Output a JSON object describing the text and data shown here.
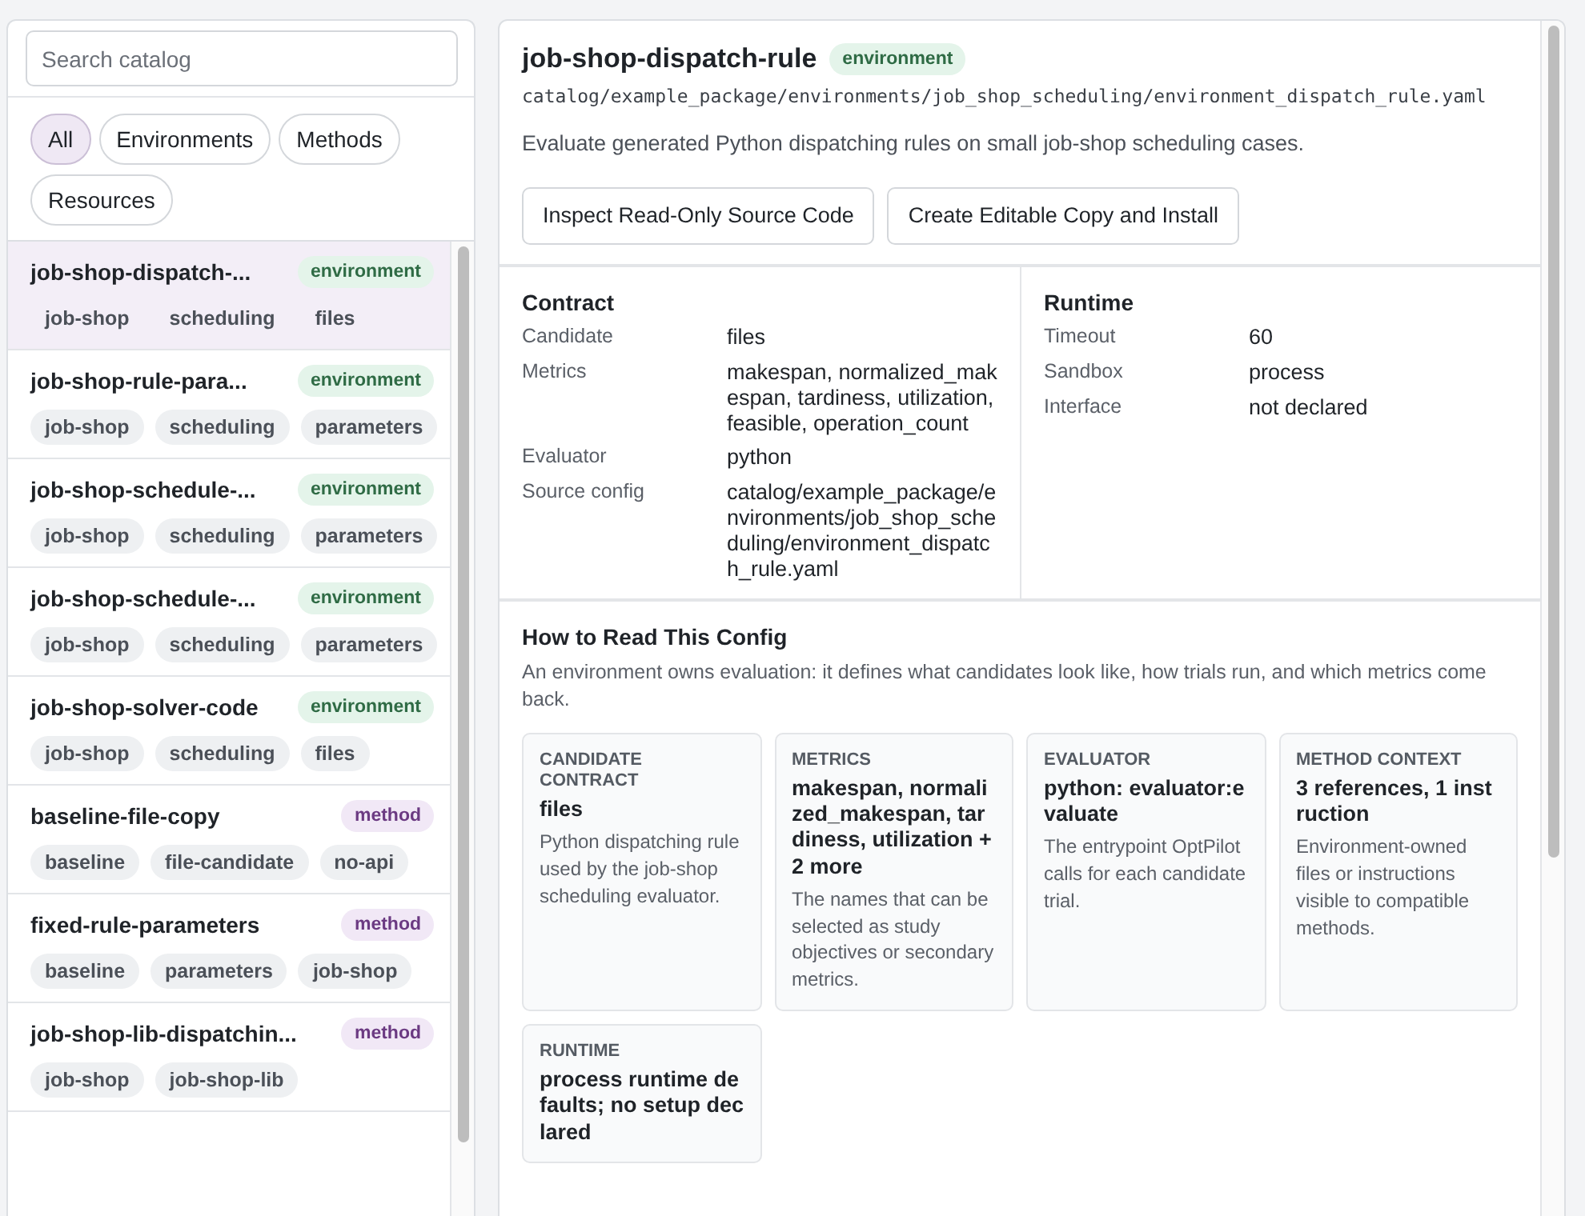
{
  "search": {
    "placeholder": "Search catalog"
  },
  "filters": [
    {
      "label": "All",
      "selected": true
    },
    {
      "label": "Environments",
      "selected": false
    },
    {
      "label": "Methods",
      "selected": false
    },
    {
      "label": "Resources",
      "selected": false
    }
  ],
  "items": [
    {
      "name": "job-shop-dispatch-...",
      "badge": "environment",
      "kind": "environment",
      "selected": true,
      "tags": [
        "job-shop",
        "scheduling",
        "files"
      ]
    },
    {
      "name": "job-shop-rule-para...",
      "badge": "environment",
      "kind": "environment",
      "selected": false,
      "tags": [
        "job-shop",
        "scheduling",
        "parameters"
      ]
    },
    {
      "name": "job-shop-schedule-...",
      "badge": "environment",
      "kind": "environment",
      "selected": false,
      "tags": [
        "job-shop",
        "scheduling",
        "parameters"
      ]
    },
    {
      "name": "job-shop-schedule-...",
      "badge": "environment",
      "kind": "environment",
      "selected": false,
      "tags": [
        "job-shop",
        "scheduling",
        "parameters"
      ]
    },
    {
      "name": "job-shop-solver-code",
      "badge": "environment",
      "kind": "environment",
      "selected": false,
      "tags": [
        "job-shop",
        "scheduling",
        "files"
      ]
    },
    {
      "name": "baseline-file-copy",
      "badge": "method",
      "kind": "method",
      "selected": false,
      "tags": [
        "baseline",
        "file-candidate",
        "no-api"
      ]
    },
    {
      "name": "fixed-rule-parameters",
      "badge": "method",
      "kind": "method",
      "selected": false,
      "tags": [
        "baseline",
        "parameters",
        "job-shop"
      ]
    },
    {
      "name": "job-shop-lib-dispatchin...",
      "badge": "method",
      "kind": "method",
      "selected": false,
      "tags": [
        "job-shop",
        "job-shop-lib"
      ]
    }
  ],
  "detail": {
    "title": "job-shop-dispatch-rule",
    "badge": "environment",
    "kind": "environment",
    "path": "catalog/example_package/environments/job_shop_scheduling/environment_dispatch_rule.yaml",
    "description": "Evaluate generated Python dispatching rules on small job-shop scheduling cases.",
    "buttons": [
      "Inspect Read-Only Source Code",
      "Create Editable Copy and Install"
    ],
    "sections": [
      {
        "title": "Contract",
        "rows": [
          {
            "label": "Candidate",
            "value": "files"
          },
          {
            "label": "Metrics",
            "value": "makespan, normalized_makespan, tardiness, utilization, feasible, operation_count"
          },
          {
            "label": "Evaluator",
            "value": "python"
          },
          {
            "label": "Source config",
            "value": "catalog/example_package/environments/job_shop_scheduling/environment_dispatch_rule.yaml"
          }
        ]
      },
      {
        "title": "Runtime",
        "rows": [
          {
            "label": "Timeout",
            "value": "60"
          },
          {
            "label": "Sandbox",
            "value": "process"
          },
          {
            "label": "Interface",
            "value": "not declared"
          }
        ]
      }
    ],
    "guide": {
      "title": "How to Read This Config",
      "intro": "An environment owns evaluation: it defines what candidates look like, how trials run, and which metrics come back.",
      "cards": [
        {
          "label": "CANDIDATE CONTRACT",
          "value": "files",
          "note": "Python dispatching rule used by the job-shop scheduling evaluator."
        },
        {
          "label": "METRICS",
          "value": "makespan, normalized_makespan, tardiness, utilization +2 more",
          "note": "The names that can be selected as study objectives or secondary metrics."
        },
        {
          "label": "EVALUATOR",
          "value": "python: evaluator:evaluate",
          "note": "The entrypoint OptPilot calls for each candidate trial."
        },
        {
          "label": "METHOD CONTEXT",
          "value": "3 references, 1 instruction",
          "note": "Environment-owned files or instructions visible to compatible methods."
        },
        {
          "label": "RUNTIME",
          "value": "process runtime defaults; no setup declared"
        }
      ]
    }
  }
}
